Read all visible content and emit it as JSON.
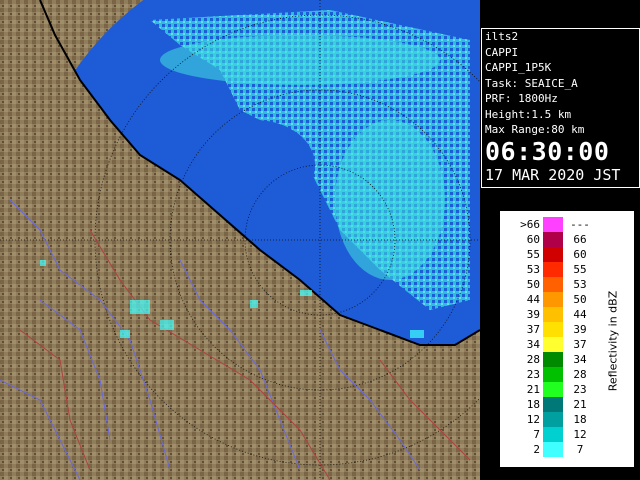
{
  "info": {
    "station": "ilts2",
    "product": "CAPPI",
    "product_code": "CAPPI_1P5K",
    "task": "Task: SEAICE_A",
    "prf": "PRF: 1800Hz",
    "height": "Height:1.5 km",
    "max_range": "Max Range:80 km",
    "time": "06:30:00",
    "date": "17 MAR 2020 JST"
  },
  "legend": {
    "title": "Reflectivity in dBZ",
    "rows": [
      {
        "lo": ">66",
        "hi": "---",
        "color": "#ff40ff"
      },
      {
        "lo": "60",
        "hi": "66",
        "color": "#b0004a"
      },
      {
        "lo": "55",
        "hi": "60",
        "color": "#d00000"
      },
      {
        "lo": "53",
        "hi": "55",
        "color": "#ff2a00"
      },
      {
        "lo": "50",
        "hi": "53",
        "color": "#ff6000"
      },
      {
        "lo": "44",
        "hi": "50",
        "color": "#ff9800"
      },
      {
        "lo": "39",
        "hi": "44",
        "color": "#ffc000"
      },
      {
        "lo": "37",
        "hi": "39",
        "color": "#ffe000"
      },
      {
        "lo": "34",
        "hi": "37",
        "color": "#ffff30"
      },
      {
        "lo": "28",
        "hi": "34",
        "color": "#008a00"
      },
      {
        "lo": "23",
        "hi": "28",
        "color": "#00c000"
      },
      {
        "lo": "21",
        "hi": "23",
        "color": "#20ff20"
      },
      {
        "lo": "18",
        "hi": "21",
        "color": "#007878"
      },
      {
        "lo": "12",
        "hi": "18",
        "color": "#00a0a0"
      },
      {
        "lo": "7",
        "hi": "12",
        "color": "#00d0d0"
      },
      {
        "lo": "2",
        "hi": "7",
        "color": "#40ffff"
      }
    ]
  },
  "colors": {
    "sea": "#1e5bd6",
    "land": "#8b7a5a",
    "rain_light": "#40ffff",
    "rain_mid": "#00a0a0"
  }
}
